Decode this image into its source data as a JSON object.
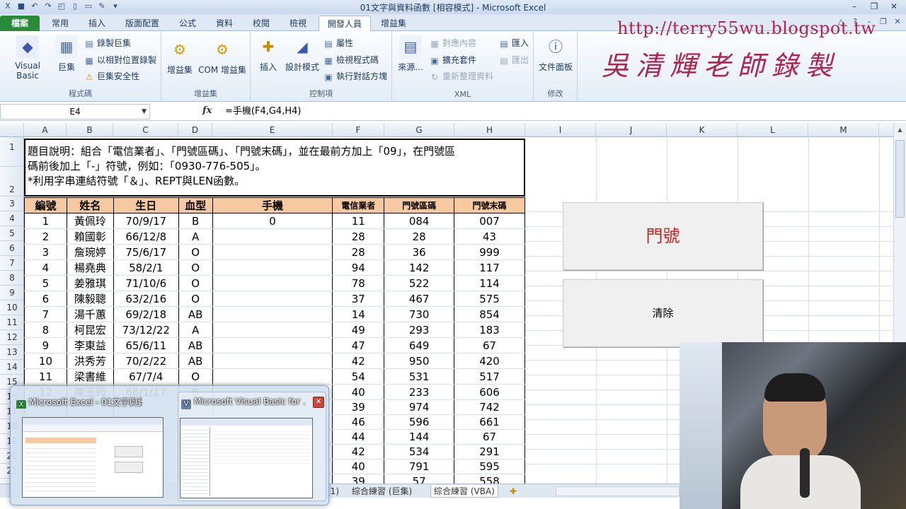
{
  "window": {
    "title": "01文字與資料函數 [相容模式] - Microsoft Excel"
  },
  "tabs": [
    "檔案",
    "常用",
    "插入",
    "版面配置",
    "公式",
    "資料",
    "校閱",
    "檢視",
    "開發人員",
    "增益集"
  ],
  "active_tab": "開發人員",
  "ribbon": {
    "code_group": {
      "name": "程式碼",
      "visual_basic": "Visual Basic",
      "macros": "巨集",
      "record_macro": "錄製巨集",
      "relative_ref": "以相對位置錄製",
      "macro_security": "巨集安全性"
    },
    "addins_group": {
      "name": "增益集",
      "addins": "增益集",
      "com_addins": "COM 增益集"
    },
    "controls_group": {
      "name": "控制項",
      "insert": "插入",
      "design_mode": "設計模式",
      "properties": "屬性",
      "view_code": "檢視程式碼",
      "run_dialog": "執行對話方塊"
    },
    "xml_group": {
      "name": "XML",
      "source": "來源...",
      "map_properties": "對應內容",
      "expansion_packs": "擴充套件",
      "refresh_data": "重新整理資料",
      "import": "匯入",
      "export": "匯出"
    },
    "modify_group": {
      "name": "修改",
      "document_panel": "文件面板"
    }
  },
  "watermark": {
    "url": "http://terry55wu.blogspot.tw",
    "name": "吳清輝老師錄製"
  },
  "formula_bar": {
    "name_box": "E4",
    "fx": "fx",
    "formula": "=手機(F4,G4,H4)"
  },
  "columns": [
    "A",
    "B",
    "C",
    "D",
    "E",
    "F",
    "G",
    "H",
    "I",
    "J",
    "K",
    "L",
    "M"
  ],
  "rows": [
    "1",
    "2",
    "3",
    "4",
    "5",
    "6",
    "7",
    "8",
    "9",
    "10",
    "11",
    "12",
    "13",
    "14",
    "15",
    "16",
    "17",
    "18",
    "19",
    "20",
    "21",
    "22"
  ],
  "description": {
    "line1": "題目說明：組合「電信業者」、「門號區碼」、「門號末碼」，並在最前方加上「09」，在門號區",
    "line2": "碼前後加上「-」符號，例如：「0930-776-505」。",
    "line3": "*利用字串連結符號「＆」、REPT與LEN函數。"
  },
  "table": {
    "headers": [
      "編號",
      "姓名",
      "生日",
      "血型",
      "手機",
      "電信業者",
      "門號區碼",
      "門號末碼"
    ],
    "rows": [
      [
        "1",
        "黃佩玲",
        "70/9/17",
        "B",
        "0",
        "11",
        "084",
        "007"
      ],
      [
        "2",
        "賴國彰",
        "66/12/8",
        "A",
        "",
        "28",
        "28",
        "43"
      ],
      [
        "3",
        "詹琬婷",
        "75/6/17",
        "O",
        "",
        "28",
        "36",
        "999"
      ],
      [
        "4",
        "楊堯典",
        "58/2/1",
        "O",
        "",
        "94",
        "142",
        "117"
      ],
      [
        "5",
        "姜雅琪",
        "71/10/6",
        "O",
        "",
        "78",
        "522",
        "114"
      ],
      [
        "6",
        "陳毅聰",
        "63/2/16",
        "O",
        "",
        "37",
        "467",
        "575"
      ],
      [
        "7",
        "湯千蕙",
        "69/2/18",
        "AB",
        "",
        "14",
        "730",
        "854"
      ],
      [
        "8",
        "柯昆宏",
        "73/12/22",
        "A",
        "",
        "49",
        "293",
        "183"
      ],
      [
        "9",
        "李東益",
        "65/6/11",
        "AB",
        "",
        "47",
        "649",
        "67"
      ],
      [
        "10",
        "洪秀芳",
        "70/2/22",
        "AB",
        "",
        "42",
        "950",
        "420"
      ],
      [
        "11",
        "梁書維",
        "67/7/4",
        "O",
        "",
        "54",
        "531",
        "517"
      ],
      [
        "12",
        "陳玉筠",
        "66/1/17",
        "B",
        "",
        "40",
        "233",
        "606"
      ],
      [
        "",
        "",
        "",
        "",
        "",
        "39",
        "974",
        "742"
      ],
      [
        "",
        "",
        "",
        "",
        "",
        "46",
        "596",
        "661"
      ],
      [
        "",
        "",
        "",
        "",
        "",
        "44",
        "144",
        "67"
      ],
      [
        "",
        "",
        "",
        "",
        "",
        "42",
        "534",
        "291"
      ],
      [
        "",
        "",
        "",
        "",
        "",
        "40",
        "791",
        "595"
      ],
      [
        "",
        "",
        "",
        "",
        "",
        "39",
        "57",
        "558"
      ]
    ]
  },
  "sheet_buttons": {
    "door": "門號",
    "clear": "清除"
  },
  "sheet_tabs": [
    "(1)",
    "綜合練習 (巨集)",
    "綜合練習 (VBA)"
  ],
  "taskbar_popup": {
    "items": [
      {
        "title": "Microsoft Excel - 01文字與資...",
        "icon": "excel-icon"
      },
      {
        "title": "Microsoft Visual Basic for ...",
        "icon": "vba-icon"
      }
    ]
  },
  "colors": {
    "header_fill": "#f6c9a1",
    "file_tab": "#2a8a3a",
    "watermark": "#b0234f",
    "door_button_text": "#d0201c"
  }
}
